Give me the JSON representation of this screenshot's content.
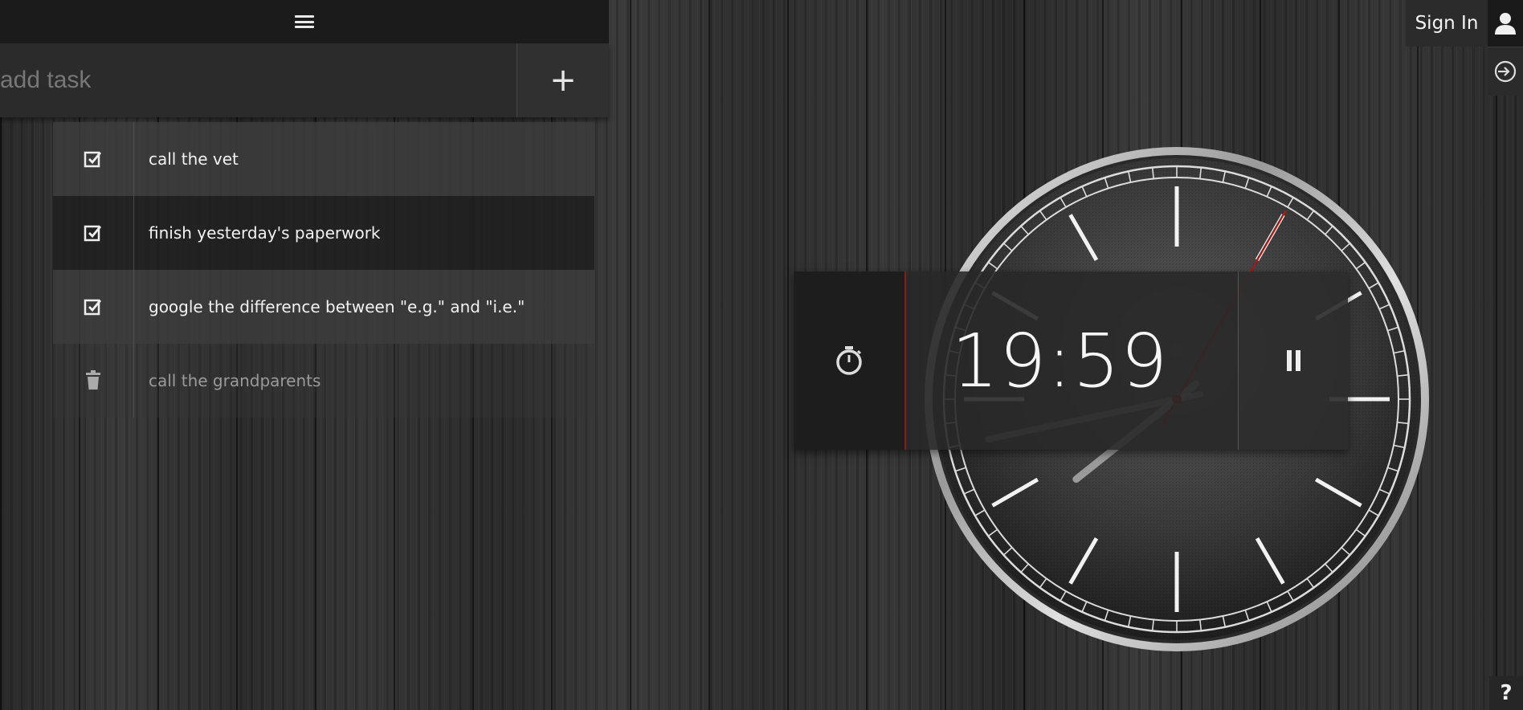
{
  "header": {
    "menu_icon": "hamburger-menu-icon"
  },
  "add_task": {
    "placeholder": "add task",
    "button_label": "+"
  },
  "tasks": [
    {
      "text": "call the vet",
      "status": "active",
      "icon": "checkbox-checked-icon"
    },
    {
      "text": "finish yesterday's paperwork",
      "status": "active",
      "icon": "checkbox-checked-icon"
    },
    {
      "text": "google the difference between \"e.g.\" and \"i.e.\"",
      "status": "active",
      "icon": "checkbox-checked-icon"
    },
    {
      "text": "call the grandparents",
      "status": "completed",
      "icon": "trash-icon"
    }
  ],
  "account": {
    "sign_in_label": "Sign In",
    "user_icon": "user-icon",
    "login_icon": "login-icon"
  },
  "help": {
    "label": "?"
  },
  "timer": {
    "display": "19:59",
    "icon": "stopwatch-icon",
    "pause_icon": "pause-icon"
  },
  "clock": {
    "hour": 7,
    "minute": 43,
    "second": 5,
    "colors": {
      "second_hand": "#a11c1c",
      "accent": "#8b1a1a"
    }
  }
}
